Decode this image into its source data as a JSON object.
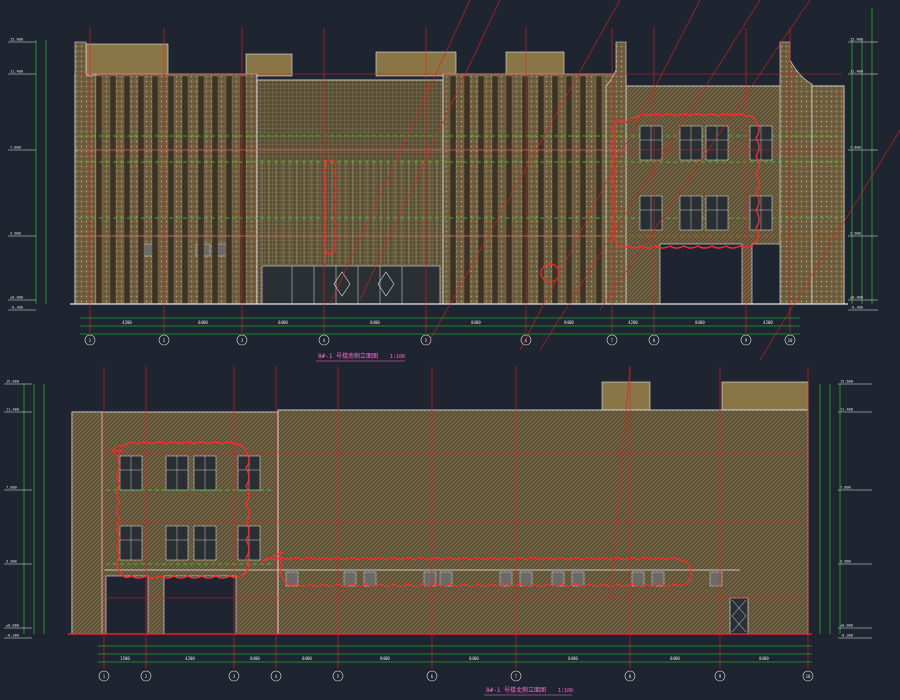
{
  "drawing": {
    "colors": {
      "background": "#1e2530",
      "facade_fill": "#6b5c3e",
      "parapet_fill": "#8a7547",
      "grid_red": "#e0201e",
      "dim_green": "#28e02a",
      "outline": "#e8e8e8",
      "revision_cloud": "#ff2a2a",
      "label_magenta": "#ff6ad0",
      "window": "#2a2f33"
    },
    "top_elevation": {
      "title": "8#-1 号楼南侧立面图",
      "scale": "1:100",
      "axis_labels": [
        "1",
        "2",
        "3",
        "4",
        "5",
        "6",
        "7",
        "8",
        "9",
        "10"
      ],
      "levels": [
        "15.600",
        "11.400",
        "7.800",
        "3.900",
        "±0.000",
        "-0.300"
      ],
      "spans": [
        "4200",
        "8400",
        "8400",
        "8400",
        "8400",
        "8400",
        "4200",
        "8400",
        "4200"
      ]
    },
    "bottom_elevation": {
      "title": "8#-1 号楼北侧立面图",
      "scale": "1:100",
      "axis_labels": [
        "1",
        "2",
        "3",
        "4",
        "5",
        "6",
        "7",
        "8",
        "9",
        "10"
      ],
      "levels": [
        "15.600",
        "11.400",
        "7.800",
        "3.900",
        "±0.000",
        "-0.300"
      ],
      "spans": [
        "1500",
        "4200",
        "8400",
        "8400",
        "8400",
        "8400",
        "8400",
        "8400",
        "8400"
      ]
    }
  }
}
